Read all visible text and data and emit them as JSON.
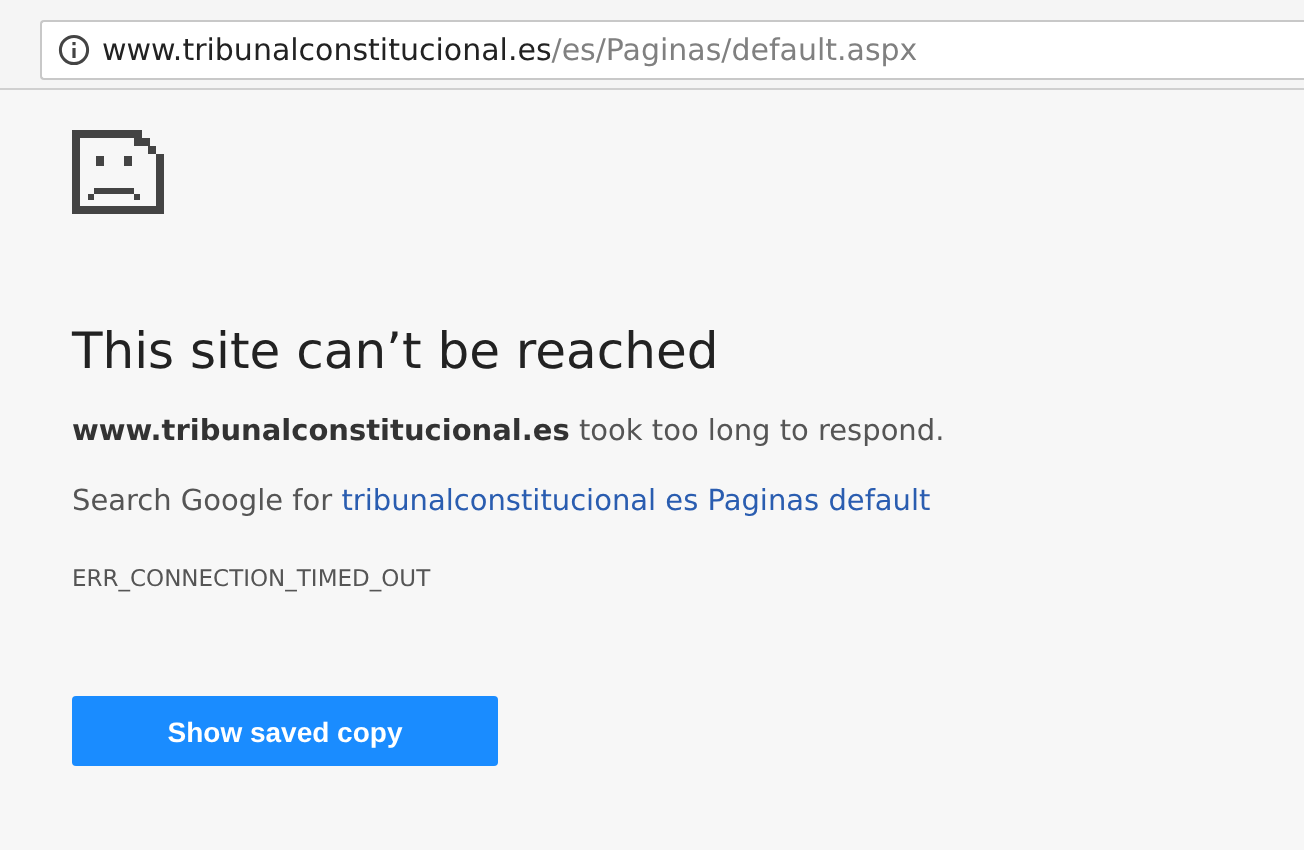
{
  "address_bar": {
    "host": "www.tribunalconstitucional.es",
    "path": "/es/Paginas/default.aspx"
  },
  "error": {
    "title": "This site can’t be reached",
    "message": "**www.tribunalconstitucional.es** took too long to respond.",
    "search_prefix": "Search Google for ",
    "search_link": "tribunalconstitucional es Paginas default",
    "code": "ERR_CONNECTION_TIMED_OUT",
    "button": "Show saved copy"
  }
}
